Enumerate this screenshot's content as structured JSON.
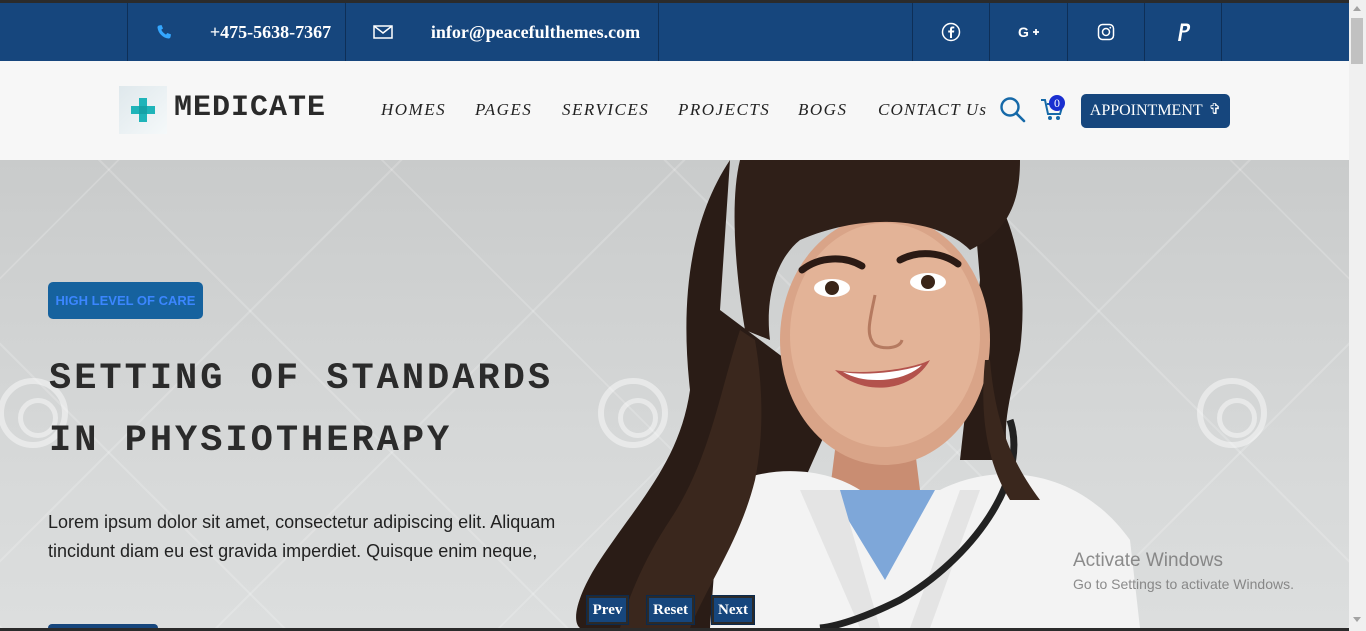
{
  "topbar": {
    "phone": "+475-5638-7367",
    "email": "infor@peacefulthemes.com",
    "social": [
      "facebook-icon",
      "google-plus-icon",
      "instagram-icon",
      "paypal-icon"
    ]
  },
  "navbar": {
    "logo_text": "MEDICATE",
    "items": [
      "HOMES",
      "PAGES",
      "SERVICES",
      "PROJECTS",
      "BOGS",
      "CONTACT Us"
    ],
    "cart_count": "0",
    "appointment_label": "APPOINTMENT",
    "appointment_icon": "✞"
  },
  "hero": {
    "badge": "HIGH LEVEL OF CARE",
    "title_line1": "SETTING OF STANDARDS",
    "title_line2": "IN PHYSIOTHERAPY",
    "description": "Lorem ipsum dolor sit amet, consectetur adipiscing elit. Aliquam tincidunt diam eu est gravida imperdiet. Quisque enim neque,",
    "prev_label": "Prev",
    "reset_label": "Reset",
    "next_label": "Next"
  },
  "os_overlay": {
    "line1": "Activate Windows",
    "line2": "Go to Settings to activate Windows."
  },
  "colors": {
    "primary": "#16467d",
    "badge_bg": "#16629e",
    "badge_text": "#3b86ff",
    "logo_accent": "#1fb4b9"
  }
}
